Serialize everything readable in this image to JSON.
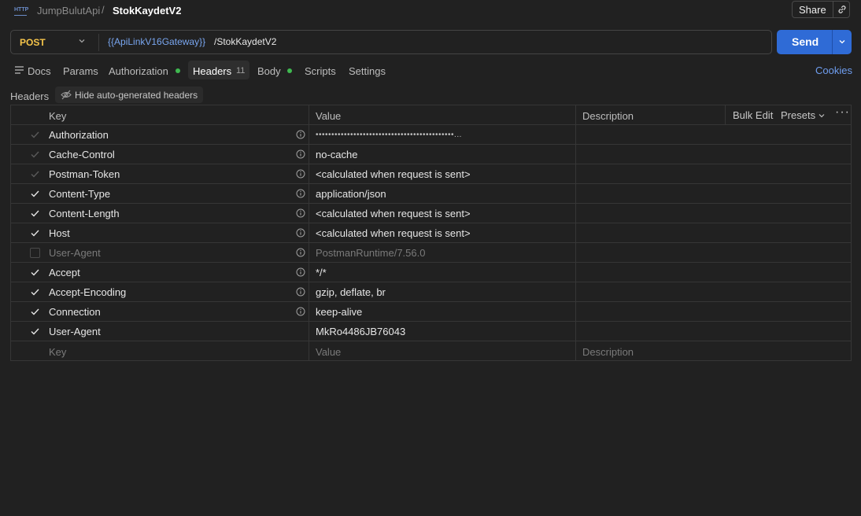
{
  "breadcrumb": {
    "icon_text": "HTTP",
    "collection": "JumpBulutApi",
    "separator": "/",
    "request_name": "StokKaydetV2"
  },
  "share": {
    "label": "Share"
  },
  "request": {
    "method": "POST",
    "url_variable": "{{ApiLinkV16Gateway}}",
    "url_path": " /StokKaydetV2"
  },
  "send": {
    "label": "Send"
  },
  "tabs": {
    "docs": "Docs",
    "params": "Params",
    "authorization": "Authorization",
    "headers": "Headers",
    "headers_count": "11",
    "body": "Body",
    "scripts": "Scripts",
    "settings": "Settings",
    "cookies": "Cookies"
  },
  "headers_bar": {
    "label": "Headers",
    "hide_auto": "Hide auto-generated headers"
  },
  "table": {
    "columns": {
      "key": "Key",
      "value": "Value",
      "description": "Description"
    },
    "tools": {
      "bulk_edit": "Bulk Edit",
      "presets": "Presets"
    },
    "rows": [
      {
        "key": "Authorization",
        "value": "••••••••••••••••••••••••••••••••••••••••••••...",
        "checked": "auto"
      },
      {
        "key": "Cache-Control",
        "value": "no-cache",
        "checked": "auto"
      },
      {
        "key": "Postman-Token",
        "value": "<calculated when request is sent>",
        "checked": "auto"
      },
      {
        "key": "Content-Type",
        "value": "application/json",
        "checked": "yes"
      },
      {
        "key": "Content-Length",
        "value": "<calculated when request is sent>",
        "checked": "yes"
      },
      {
        "key": "Host",
        "value": "<calculated when request is sent>",
        "checked": "yes"
      },
      {
        "key": "User-Agent",
        "value": "PostmanRuntime/7.56.0",
        "checked": "no"
      },
      {
        "key": "Accept",
        "value": "*/*",
        "checked": "yes"
      },
      {
        "key": "Accept-Encoding",
        "value": "gzip, deflate, br",
        "checked": "yes"
      },
      {
        "key": "Connection",
        "value": "keep-alive",
        "checked": "yes"
      },
      {
        "key": "User-Agent",
        "value": "MkRo4486JB76043",
        "checked": "yes"
      }
    ],
    "new_row": {
      "key_placeholder": "Key",
      "value_placeholder": "Value",
      "description_placeholder": "Description"
    }
  },
  "colors": {
    "method": "#f5c44a",
    "variable": "#79a6f0",
    "send": "#2f6bd6",
    "dot": "#3fb950",
    "cookies": "#6f9ef0"
  }
}
